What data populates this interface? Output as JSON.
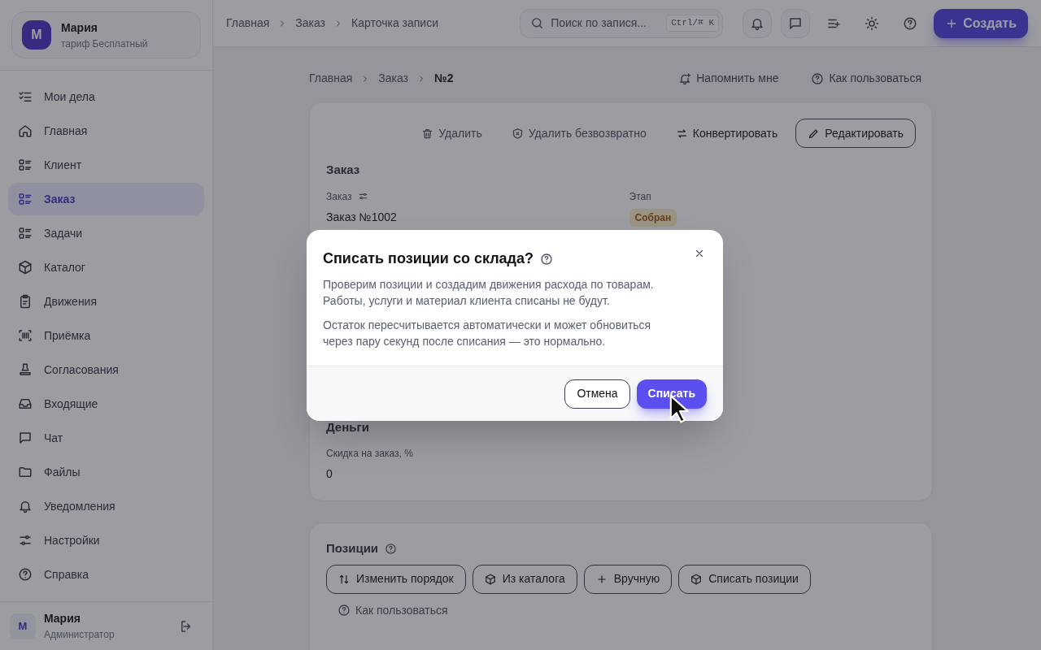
{
  "account": {
    "initial": "М",
    "name": "Мария",
    "plan": "тариф Бесплатный"
  },
  "sidebar": {
    "items": [
      {
        "label": "Мои дела",
        "selected": false
      },
      {
        "label": "Главная",
        "selected": false
      },
      {
        "label": "Клиент",
        "selected": false
      },
      {
        "label": "Заказ",
        "selected": true
      },
      {
        "label": "Задачи",
        "selected": false
      },
      {
        "label": "Каталог",
        "selected": false
      },
      {
        "label": "Движения",
        "selected": false
      },
      {
        "label": "Приёмка",
        "selected": false
      },
      {
        "label": "Согласования",
        "selected": false
      },
      {
        "label": "Входящие",
        "selected": false
      },
      {
        "label": "Чат",
        "selected": false
      },
      {
        "label": "Файлы",
        "selected": false
      },
      {
        "label": "Уведомления",
        "selected": false
      },
      {
        "label": "Настройки",
        "selected": false
      },
      {
        "label": "Справка",
        "selected": false
      }
    ]
  },
  "user": {
    "initial": "М",
    "name": "Мария",
    "role": "Администратор"
  },
  "topbar": {
    "breadcrumbs": [
      "Главная",
      "Заказ",
      "Карточка записи"
    ],
    "search": {
      "placeholder": "Поиск по запися...",
      "shortcut": "Ctrl/⌘ K"
    },
    "create_button": "Создать"
  },
  "page": {
    "breadcrumbs": [
      "Главная",
      "Заказ",
      "№2"
    ],
    "remind": "Напомнить мне",
    "howto": "Как пользоваться"
  },
  "record_card": {
    "actions": [
      "Удалить",
      "Удалить безвозвратно",
      "Конвертировать",
      "Редактировать"
    ],
    "section": "Заказ",
    "fields": [
      {
        "label": "Заказ",
        "value": "Заказ №1002"
      },
      {
        "label": "Этап",
        "badge": "Собран"
      }
    ],
    "money_section": "Деньги",
    "money_fields": [
      {
        "label": "Скидка на заказ, %",
        "value": "0"
      }
    ]
  },
  "positions_card": {
    "title": "Позиции",
    "buttons": [
      "Изменить порядок",
      "Из каталога",
      "Вручную",
      "Списать позиции"
    ],
    "howto": "Как пользоваться"
  },
  "dialog": {
    "title": "Списать позиции со склада?",
    "paragraphs": [
      "Проверим позиции и создадим движения расхода по товарам. Работы, услуги и материал клиента списаны не будут.",
      "Остаток пересчитывается автоматически и может обновиться через пару секунд после списания — это нормально."
    ],
    "cancel": "Отмена",
    "confirm": "Списать"
  }
}
